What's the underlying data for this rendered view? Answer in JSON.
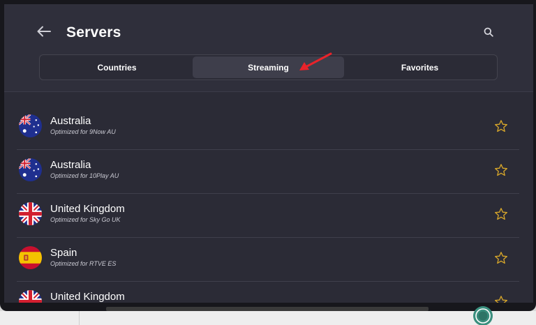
{
  "header": {
    "title": "Servers",
    "back_icon": "arrow-left-icon",
    "search_icon": "search-icon"
  },
  "tabs": [
    {
      "label": "Countries",
      "active": false
    },
    {
      "label": "Streaming",
      "active": true
    },
    {
      "label": "Favorites",
      "active": false
    }
  ],
  "servers": [
    {
      "country": "Australia",
      "subtitle": "Optimized for 9Now AU",
      "flag": "australia-flag-icon"
    },
    {
      "country": "Australia",
      "subtitle": "Optimized for 10Play AU",
      "flag": "australia-flag-icon"
    },
    {
      "country": "United Kingdom",
      "subtitle": "Optimized for Sky Go UK",
      "flag": "uk-flag-icon"
    },
    {
      "country": "Spain",
      "subtitle": "Optimized for RTVE ES",
      "flag": "spain-flag-icon"
    },
    {
      "country": "United Kingdom",
      "subtitle": "",
      "flag": "uk-flag-icon"
    }
  ],
  "colors": {
    "background": "#2b2b36",
    "header": "#2f2f3b",
    "active_tab": "#3e3e4b",
    "star": "#d8a72a",
    "annotation_arrow": "#e8232a"
  }
}
